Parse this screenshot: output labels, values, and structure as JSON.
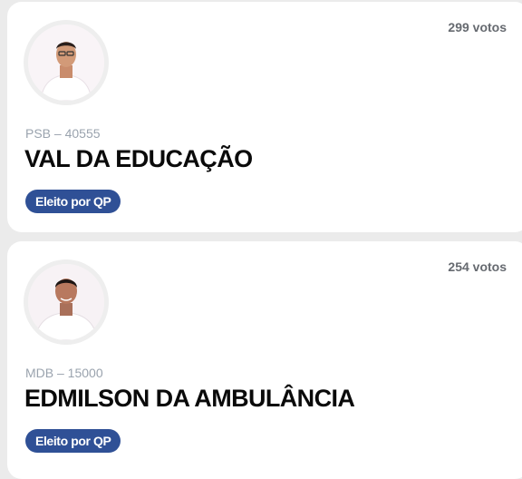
{
  "colors": {
    "page_background": "#ebebeb",
    "card_background": "#ffffff",
    "badge_background": "#2f5096",
    "name_text": "#0a0a0a",
    "party_text": "#9aa3ae",
    "votes_text": "#666a70"
  },
  "candidates": [
    {
      "votes": "299 votos",
      "party_number": "PSB – 40555",
      "name": "VAL DA EDUCAÇÃO",
      "status_badge": "Eleito por QP",
      "avatar_icon": "candidate-photo"
    },
    {
      "votes": "254 votos",
      "party_number": "MDB – 15000",
      "name": "EDMILSON DA AMBULÂNCIA",
      "status_badge": "Eleito por QP",
      "avatar_icon": "candidate-photo"
    }
  ]
}
